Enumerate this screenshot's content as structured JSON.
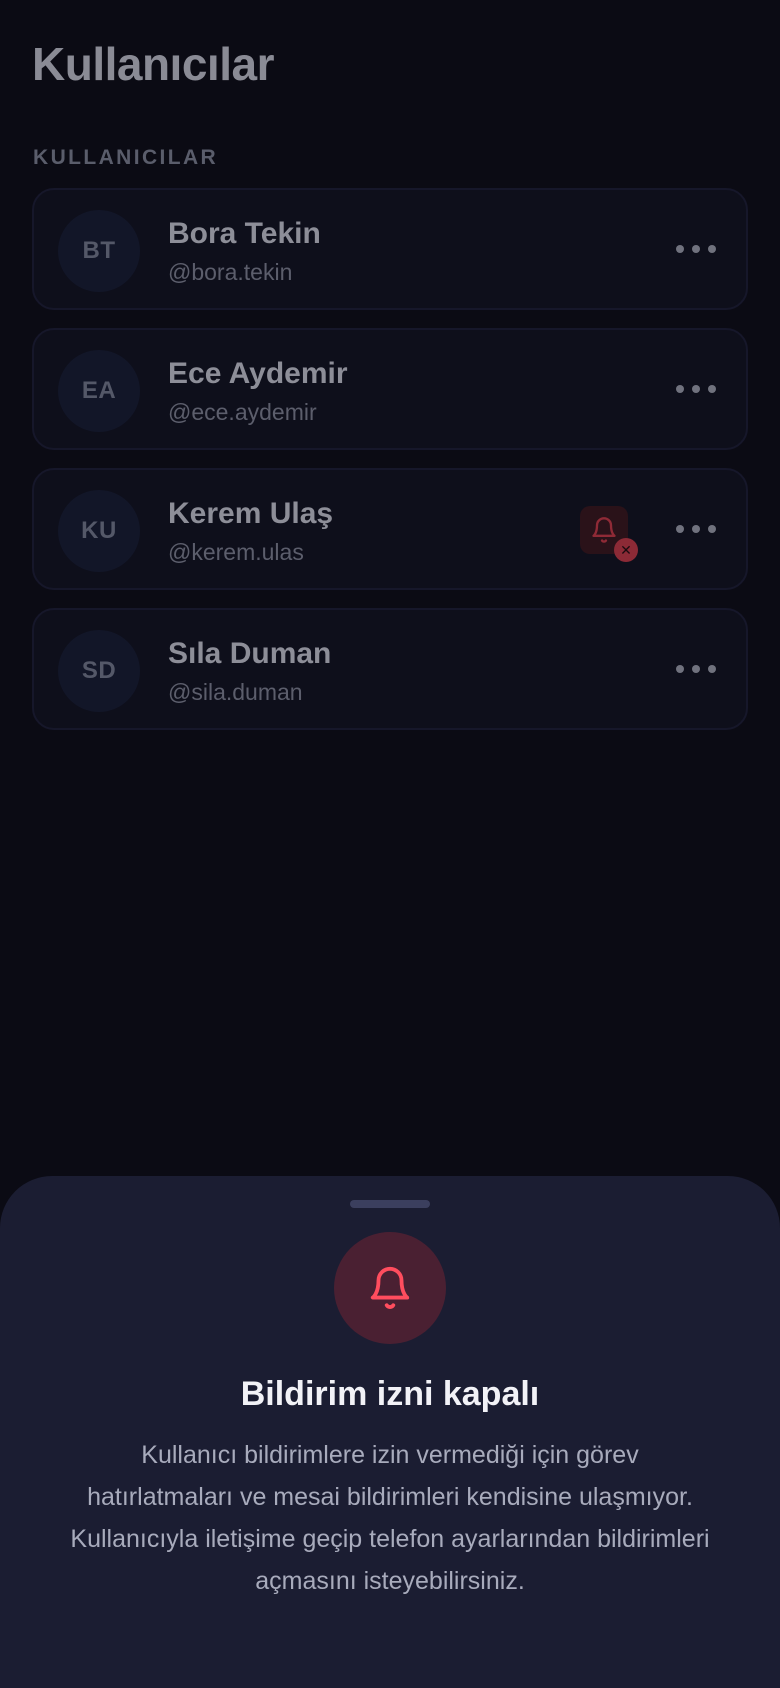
{
  "header": {
    "title": "Kullanıcılar"
  },
  "section": {
    "label": "KULLANICILAR"
  },
  "users": [
    {
      "initials": "BT",
      "name": "Bora Tekin",
      "handle": "@bora.tekin",
      "notifications_blocked": false
    },
    {
      "initials": "EA",
      "name": "Ece Aydemir",
      "handle": "@ece.aydemir",
      "notifications_blocked": false
    },
    {
      "initials": "KU",
      "name": "Kerem Ulaş",
      "handle": "@kerem.ulas",
      "notifications_blocked": true
    },
    {
      "initials": "SD",
      "name": "Sıla Duman",
      "handle": "@sila.duman",
      "notifications_blocked": false
    }
  ],
  "icons": {
    "more": "more-horizontal-icon",
    "notification_off": "bell-off-icon",
    "close": "close-icon",
    "sheet": "bell-icon"
  },
  "sheet": {
    "title": "Bildirim izni kapalı",
    "body": "Kullanıcı bildirimlere izin vermediği için görev hatırlatmaları ve mesai bildirimleri kendisine ulaşmıyor. Kullanıcıyla iletişime geçip telefon ayarlarından bildirimleri açmasını isteyebilirsiniz."
  },
  "colors": {
    "background": "#0b0b14",
    "sheet_background": "#1b1d32",
    "danger": "#ff4d5e",
    "badge_background": "#2a1219"
  }
}
